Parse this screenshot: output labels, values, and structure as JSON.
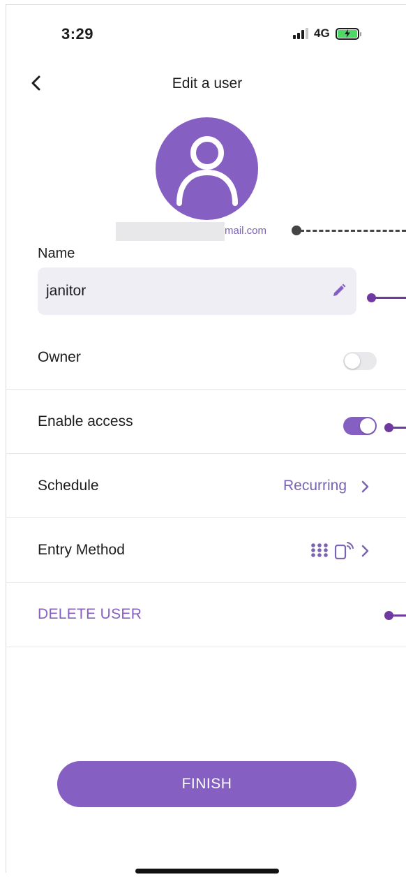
{
  "status_bar": {
    "time": "3:29",
    "network": "4G"
  },
  "header": {
    "title": "Edit a user"
  },
  "profile": {
    "email_suffix": "mail.com"
  },
  "name_field": {
    "label": "Name",
    "value": "janitor"
  },
  "rows": {
    "owner": {
      "label": "Owner",
      "enabled": false
    },
    "enable_access": {
      "label": "Enable access",
      "enabled": true
    },
    "schedule": {
      "label": "Schedule",
      "value": "Recurring"
    },
    "entry_method": {
      "label": "Entry Method"
    }
  },
  "actions": {
    "delete_label": "DELETE USER",
    "finish_label": "FINISH"
  },
  "colors": {
    "accent": "#8560c2",
    "accent_text": "#7a64b0",
    "field_bg": "#efeef4",
    "callout": "#6e3aa0"
  },
  "icons": [
    "back-chevron-icon",
    "user-avatar-icon",
    "pencil-icon",
    "keypad-icon",
    "phone-tap-icon",
    "chevron-right-icon"
  ]
}
